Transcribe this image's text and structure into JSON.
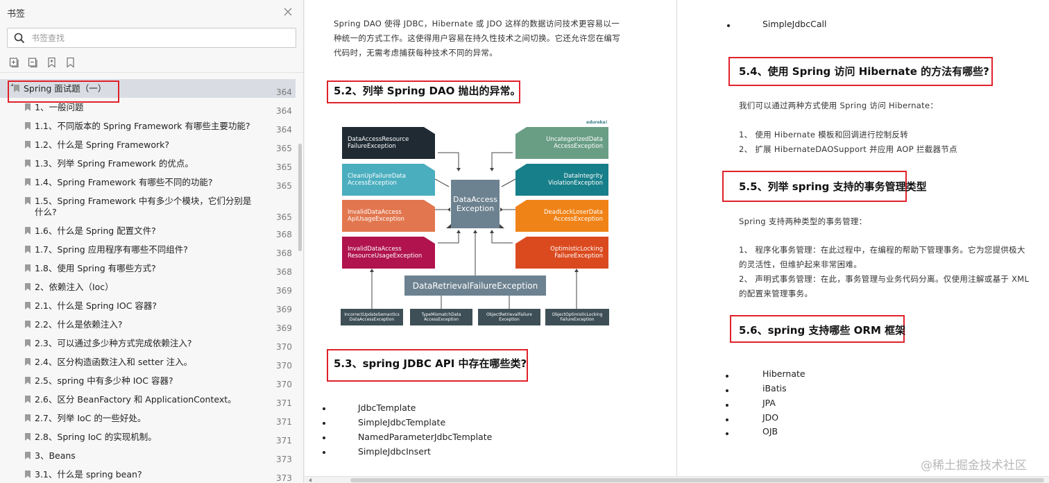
{
  "sidebar": {
    "title": "书签",
    "search_placeholder": "书签查找",
    "toc": [
      {
        "label": "Spring 面试题（一）",
        "page": "364"
      },
      {
        "label": "1、一般问题",
        "page": "364"
      },
      {
        "label": "1.1、不同版本的 Spring Framework 有哪些主要功能?",
        "page": "364"
      },
      {
        "label": "1.2、什么是 Spring Framework?",
        "page": "365"
      },
      {
        "label": "1.3、列举 Spring Framework 的优点。",
        "page": "365"
      },
      {
        "label": "1.4、Spring Framework 有哪些不同的功能?",
        "page": "365"
      },
      {
        "label": "1.5、Spring Framework 中有多少个模块，它们分别是",
        "label2": "什么?",
        "page": "365"
      },
      {
        "label": "1.6、什么是 Spring 配置文件?",
        "page": "368"
      },
      {
        "label": "1.7、Spring 应用程序有哪些不同组件?",
        "page": "368"
      },
      {
        "label": "1.8、使用 Spring 有哪些方式?",
        "page": "368"
      },
      {
        "label": "2、依赖注入（Ioc）",
        "page": "369"
      },
      {
        "label": "2.1、什么是 Spring IOC 容器?",
        "page": "369"
      },
      {
        "label": "2.2、什么是依赖注入?",
        "page": "369"
      },
      {
        "label": "2.3、可以通过多少种方式完成依赖注入?",
        "page": "370"
      },
      {
        "label": "2.4、区分构造函数注入和 setter 注入。",
        "page": "370"
      },
      {
        "label": "2.5、spring 中有多少种 IOC 容器?",
        "page": "370"
      },
      {
        "label": "2.6、区分 BeanFactory 和 ApplicationContext。",
        "page": "371"
      },
      {
        "label": "2.7、列举 IoC 的一些好处。",
        "page": "371"
      },
      {
        "label": "2.8、Spring IoC 的实现机制。",
        "page": "371"
      },
      {
        "label": "3、Beans",
        "page": "373"
      },
      {
        "label": "3.1、什么是 spring bean?",
        "page": "373"
      }
    ]
  },
  "doc": {
    "left": {
      "intro_lines": [
        "Spring DAO  使得  JDBC，Hibernate  或  JDO  这样的数据访问技术更容易以一",
        "种统一的方式工作。这使得用户容易在持久性技术之间切换。它还允许您在编写",
        "代码时，无需考虑捕获每种技术不同的异常。"
      ],
      "h52": "5.2、列举  Spring DAO  抛出的异常。",
      "h53": "5.3、spring JDBC API  中存在哪些类?",
      "classes": [
        "JdbcTemplate",
        "SimpleJdbcTemplate",
        "NamedParameterJdbcTemplate",
        "SimpleJdbcInsert"
      ]
    },
    "diagram": {
      "brand": "edureka!",
      "left": [
        {
          "l1": "DataAccessResource",
          "l2": "FailureException",
          "color": "#1f2a33"
        },
        {
          "l1": "CleanUpFailureData",
          "l2": "AccessException",
          "color": "#4aaebf"
        },
        {
          "l1": "InvalidDataAccess",
          "l2": "ApiUsageException",
          "color": "#e2774f"
        },
        {
          "l1": "InvalidDataAccess",
          "l2": "ResourceUsageException",
          "color": "#b0134d"
        }
      ],
      "right": [
        {
          "l1": "UncategorizedData",
          "l2": "AccessException",
          "color": "#6a9e84"
        },
        {
          "l1": "DataIntegrity",
          "l2": "ViolationException",
          "color": "#177f8a"
        },
        {
          "l1": "DeadLockLoserData",
          "l2": "AccessException",
          "color": "#f08318"
        },
        {
          "l1": "OptimisticLocking",
          "l2": "FailureException",
          "color": "#db4a1f"
        }
      ],
      "center_l1": "DataAccess",
      "center_l2": "Exception",
      "retrieval": "DataRetrievalFailureException",
      "bottom": [
        {
          "l1": "IncorrectUpdateSemantics",
          "l2": "DataAccessException"
        },
        {
          "l1": "TypeMismatchData",
          "l2": "AccessException"
        },
        {
          "l1": "ObjectRetrievalFailure",
          "l2": "Exception"
        },
        {
          "l1": "ObjectOptimisticLocking",
          "l2": "FailureException"
        }
      ]
    },
    "right": {
      "top_item": "SimpleJdbcCall",
      "h54": "5.4、使用  Spring  访问  Hibernate  的方法有哪些?",
      "p54": "我们可以通过两种方式使用  Spring  访问  Hibernate：",
      "m54": [
        "1、    使用  Hibernate  模板和回调进行控制反转",
        "2、    扩展  HibernateDAOSupport  并应用  AOP  拦截器节点"
      ],
      "h55": "5.5、列举  spring  支持的事务管理类型",
      "p55": "Spring  支持两种类型的事务管理：",
      "m55": [
        "1、    程序化事务管理：在此过程中，在编程的帮助下管理事务。它为您提供极大",
        "的灵活性，但维护起来非常困难。",
        "2、    声明式事务管理：在此，事务管理与业务代码分离。仅使用注解或基于    XML",
        "的配置来管理事务。"
      ],
      "h56": "5.6、spring  支持哪些  ORM  框架",
      "orms": [
        "Hibernate",
        "iBatis",
        "JPA",
        "JDO",
        "OJB"
      ]
    },
    "watermark": "@稀土掘金技术社区"
  }
}
